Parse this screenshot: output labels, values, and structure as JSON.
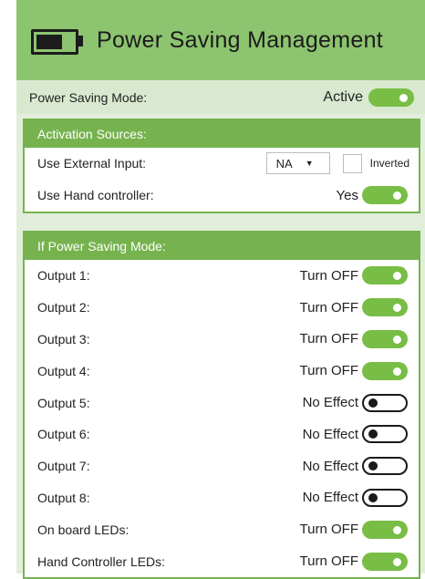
{
  "header": {
    "title": "Power Saving Management",
    "icon": "battery-icon"
  },
  "mode": {
    "label": "Power Saving Mode:",
    "value": "Active",
    "on": true
  },
  "activation": {
    "title": "Activation Sources:",
    "external_input": {
      "label": "Use External Input:",
      "selected": "NA",
      "inverted_label": "Inverted",
      "inverted": false
    },
    "hand_controller": {
      "label": "Use Hand controller:",
      "value": "Yes",
      "on": true
    }
  },
  "effects": {
    "title": "If Power Saving Mode:",
    "rows": [
      {
        "label": "Output 1:",
        "value": "Turn OFF",
        "on": true
      },
      {
        "label": "Output 2:",
        "value": "Turn OFF",
        "on": true
      },
      {
        "label": "Output 3:",
        "value": "Turn OFF",
        "on": true
      },
      {
        "label": "Output 4:",
        "value": "Turn OFF",
        "on": true
      },
      {
        "label": "Output 5:",
        "value": "No Effect",
        "on": false
      },
      {
        "label": "Output 6:",
        "value": "No Effect",
        "on": false
      },
      {
        "label": "Output 7:",
        "value": "No Effect",
        "on": false
      },
      {
        "label": "Output 8:",
        "value": "No Effect",
        "on": false
      },
      {
        "label": "On board LEDs:",
        "value": "Turn OFF",
        "on": true
      },
      {
        "label": "Hand Controller LEDs:",
        "value": "Turn OFF",
        "on": true
      }
    ]
  },
  "colors": {
    "accent": "#76b34f",
    "header": "#8dc46f",
    "toggle_on": "#78bd45",
    "panel_bg": "#e2eedb"
  }
}
